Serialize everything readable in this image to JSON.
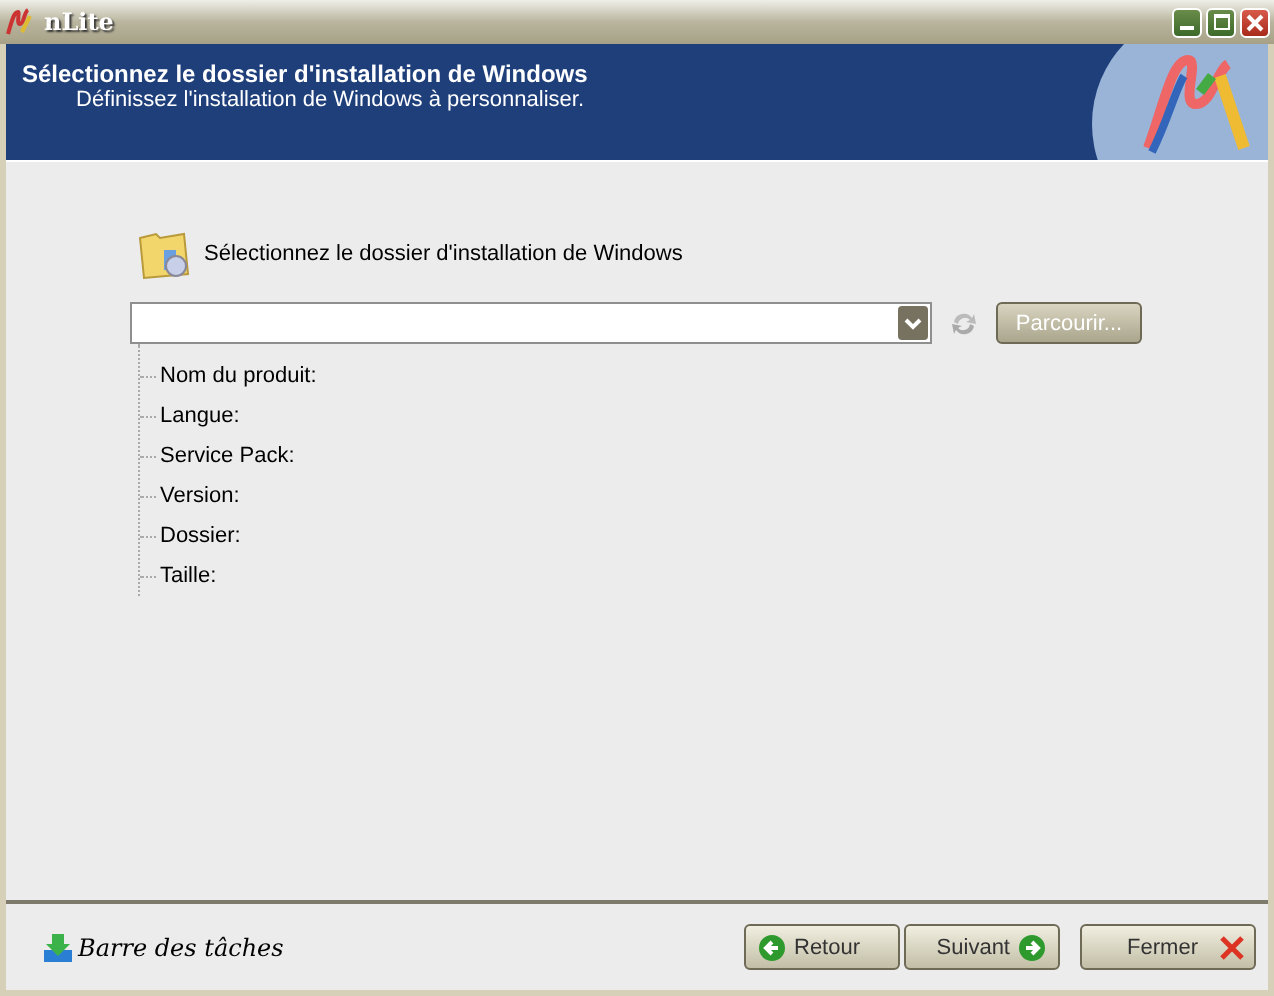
{
  "window": {
    "title": "nLite"
  },
  "header": {
    "title": "Sélectionnez le dossier d'installation de Windows",
    "subtitle": "Définissez l'installation de Windows à personnaliser."
  },
  "folder_section": {
    "label": "Sélectionnez le dossier d'installation de Windows",
    "browse_button": "Parcourir..."
  },
  "info_items": [
    {
      "label": "Nom du produit:"
    },
    {
      "label": "Langue:"
    },
    {
      "label": "Service Pack:"
    },
    {
      "label": "Version:"
    },
    {
      "label": "Dossier:"
    },
    {
      "label": "Taille:"
    }
  ],
  "footer": {
    "taskbar_link": "Barre des tâches",
    "buttons": [
      {
        "label": "Retour",
        "kind": "back"
      },
      {
        "label": "Suivant",
        "kind": "next"
      },
      {
        "label": "Fermer",
        "kind": "close"
      }
    ]
  }
}
